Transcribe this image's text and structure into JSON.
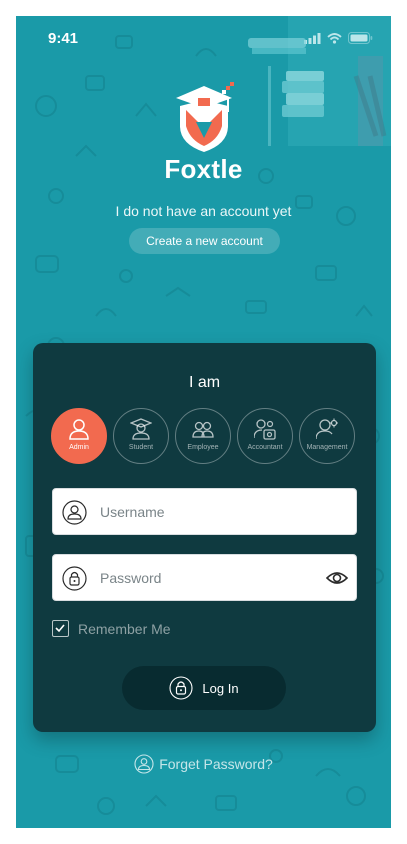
{
  "status_bar": {
    "time": "9:41"
  },
  "brand": {
    "name": "Foxtle"
  },
  "signup": {
    "prompt": "I do not have an account yet",
    "button_label": "Create a new account"
  },
  "login_card": {
    "title": "I am",
    "roles": [
      {
        "label": "Admin",
        "icon": "admin-icon",
        "selected": true
      },
      {
        "label": "Student",
        "icon": "student-icon",
        "selected": false
      },
      {
        "label": "Employee",
        "icon": "employee-icon",
        "selected": false
      },
      {
        "label": "Accountant",
        "icon": "accountant-icon",
        "selected": false
      },
      {
        "label": "Management",
        "icon": "management-icon",
        "selected": false
      }
    ],
    "username": {
      "placeholder": "Username",
      "value": "",
      "icon": "user-icon"
    },
    "password": {
      "placeholder": "Password",
      "value": "",
      "icon": "lock-icon",
      "toggle_icon": "eye-icon"
    },
    "remember_me": {
      "label": "Remember Me",
      "checked": true
    },
    "login_button": {
      "label": "Log In",
      "icon": "lock-icon"
    }
  },
  "forgot_password": {
    "label": "Forget Password?",
    "icon": "user-icon"
  },
  "colors": {
    "background": "#1a9aa8",
    "card": "#0f3a40",
    "accent": "#f26a4f",
    "button": "#082b30"
  }
}
